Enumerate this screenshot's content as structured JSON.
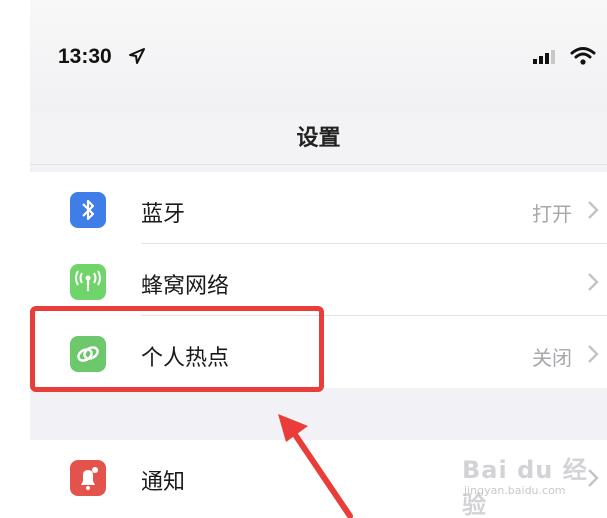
{
  "status_bar": {
    "time": "13:30",
    "location_icon": "location-arrow-icon",
    "signal_icon": "cellular-signal-icon",
    "wifi_icon": "wifi-icon",
    "battery_icon": "battery-icon"
  },
  "header": {
    "title": "设置"
  },
  "settings": {
    "rows": [
      {
        "label": "蓝牙",
        "value": "打开",
        "icon": "bluetooth-icon",
        "icon_color": "#3f7de8"
      },
      {
        "label": "蜂窝网络",
        "value": "",
        "icon": "cellular-antenna-icon",
        "icon_color": "#6fd46a"
      },
      {
        "label": "个人热点",
        "value": "关闭",
        "icon": "personal-hotspot-icon",
        "icon_color": "#6dc86b"
      }
    ],
    "group2_rows": [
      {
        "label": "通知",
        "value": "",
        "icon": "notification-bell-icon",
        "icon_color": "#e4534b"
      }
    ]
  },
  "annotation": {
    "highlight_color": "#e83d38"
  },
  "watermark": {
    "main": "Bai du 经验",
    "sub": "jingyan.baidu.com"
  }
}
